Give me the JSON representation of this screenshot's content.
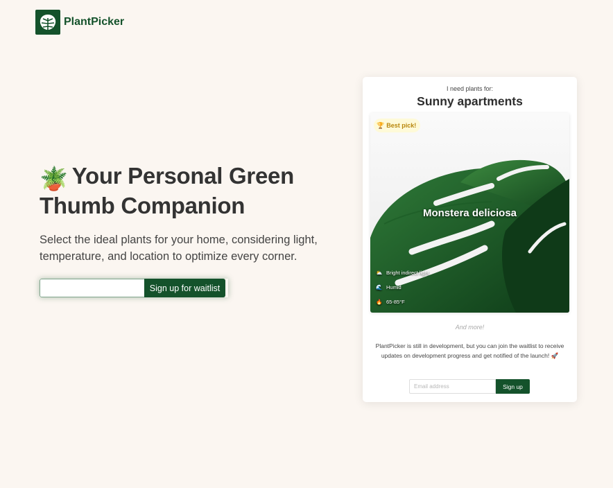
{
  "brand": {
    "name": "PlantPicker",
    "logo_icon": "monstera-leaf-icon",
    "color": "#14522b"
  },
  "hero": {
    "emoji": "🪴",
    "title": "Your Personal Green Thumb Companion",
    "subtitle": "Select the ideal plants for your home, considering light, temperature, and location to optimize every corner.",
    "email_value": "",
    "signup_label": "Sign up for waitlist"
  },
  "card": {
    "intro": "I need plants for:",
    "use_case": "Sunny apartments",
    "best_pick": {
      "icon": "🏆",
      "label": "Best pick!"
    },
    "plant_name": "Monstera deliciosa",
    "conditions": [
      {
        "icon": "⛅",
        "label": "Bright indirect light"
      },
      {
        "icon": "🌊",
        "label": "Humid"
      },
      {
        "icon": "🔥",
        "label": "65-85°F"
      }
    ],
    "more": "And more!",
    "dev_note": "PlantPicker is still in development, but you can join the waitlist to receive updates on development progress and get notified of the launch! 🚀",
    "email_placeholder": "Email address",
    "signup_label": "Sign up"
  },
  "colors": {
    "background": "#fbf6f1",
    "accent": "#14522b",
    "badge_text": "#b8860b"
  }
}
